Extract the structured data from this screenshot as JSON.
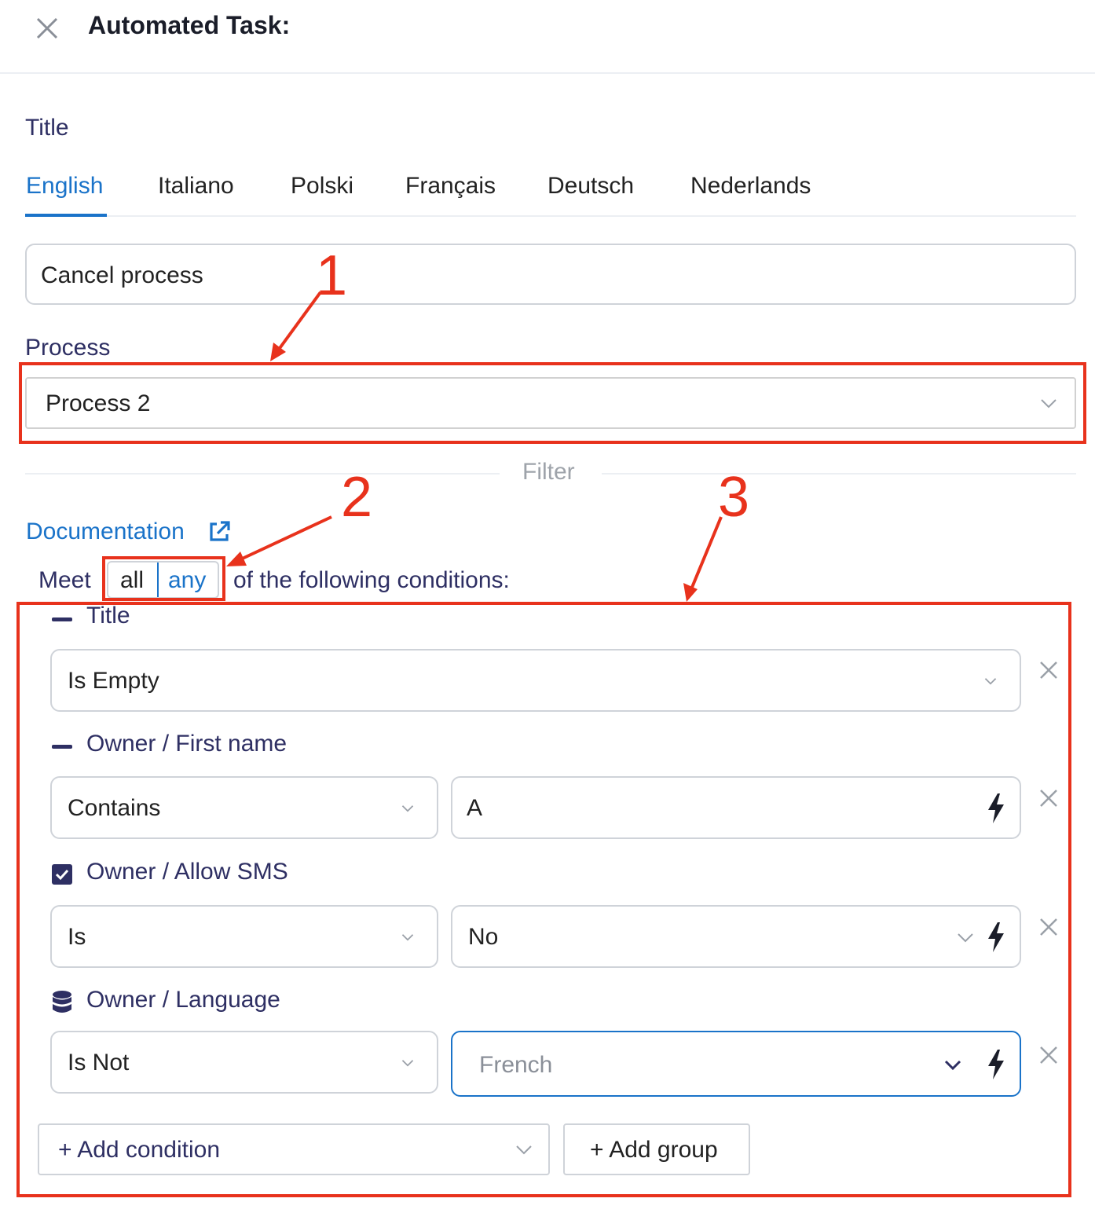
{
  "header": {
    "title": "Automated Task:"
  },
  "title_section": {
    "label": "Title",
    "tabs": [
      {
        "label": "English",
        "active": true
      },
      {
        "label": "Italiano"
      },
      {
        "label": "Polski"
      },
      {
        "label": "Français"
      },
      {
        "label": "Deutsch"
      },
      {
        "label": "Nederlands"
      }
    ],
    "value": "Cancel process"
  },
  "process_section": {
    "label": "Process",
    "selected": "Process 2"
  },
  "filter": {
    "divider_label": "Filter",
    "documentation_link": "Documentation",
    "meet_prefix": "Meet",
    "toggle": {
      "all": "all",
      "any": "any",
      "selected": "any"
    },
    "meet_suffix": "of the following conditions:",
    "conditions": [
      {
        "field": "Title",
        "icon": "minus-icon",
        "operator": "Is Empty"
      },
      {
        "field": "Owner / First name",
        "icon": "minus-icon",
        "operator": "Contains",
        "value": "A"
      },
      {
        "field": "Owner / Allow SMS",
        "icon": "checkbox-checked-icon",
        "operator": "Is",
        "value": "No"
      },
      {
        "field": "Owner / Language",
        "icon": "database-icon",
        "operator": "Is Not",
        "value_placeholder": "French"
      }
    ],
    "add_condition": "+ Add condition",
    "add_group": "+ Add group"
  },
  "annotations": [
    "1",
    "2",
    "3"
  ],
  "colors": {
    "accent": "#1a73c9",
    "label": "#2e2f63",
    "annotation": "#e8321c"
  }
}
